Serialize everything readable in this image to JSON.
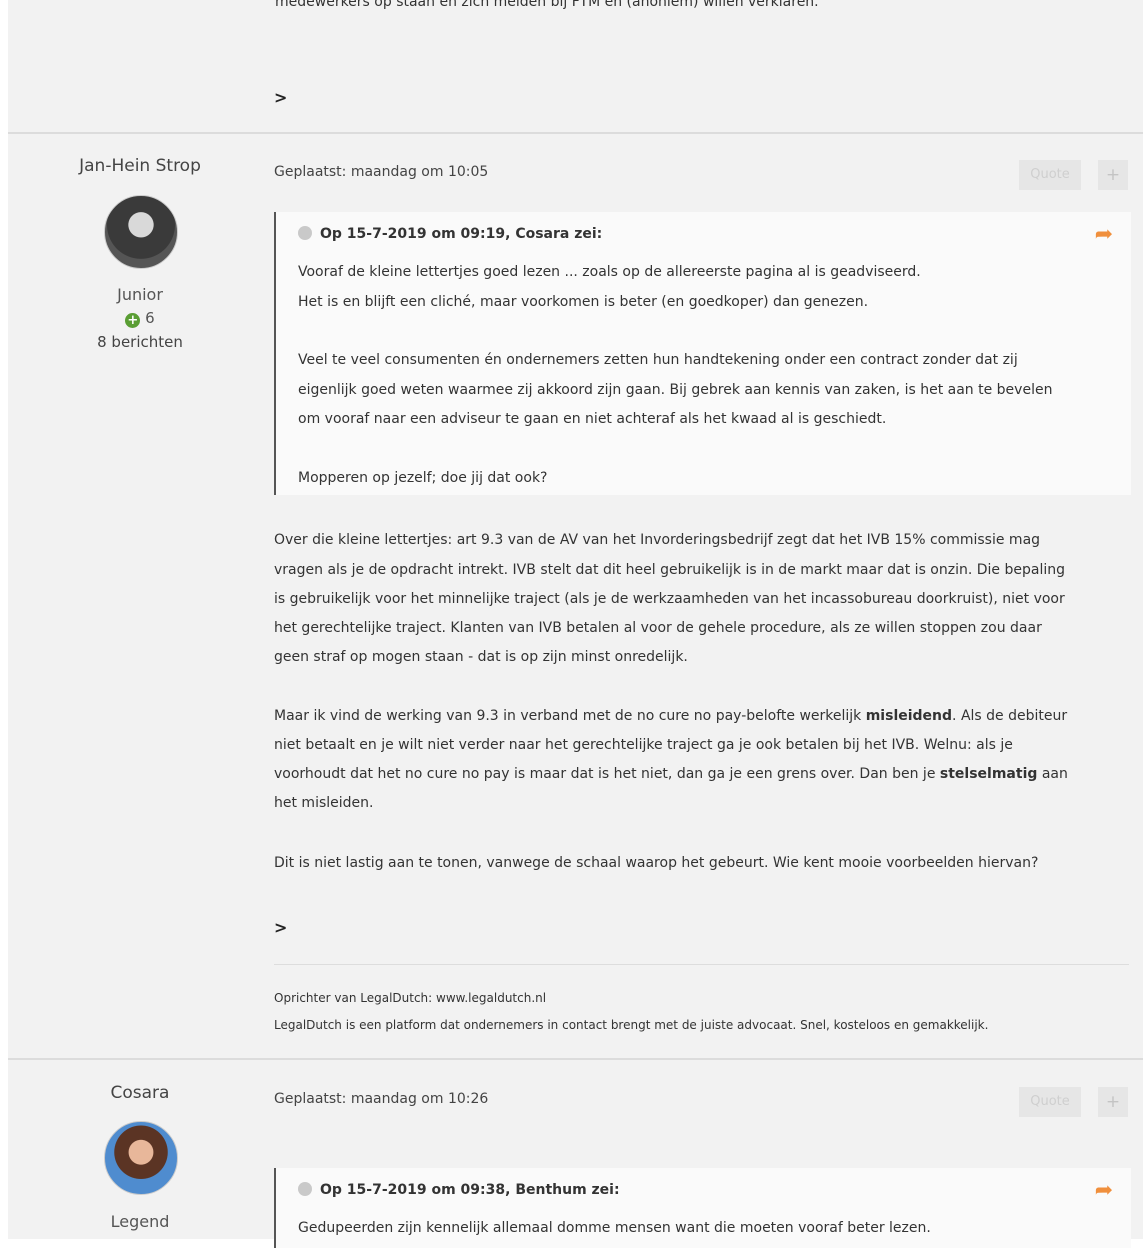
{
  "prev_post": {
    "tail_text": "medewerkers op staan en zich melden bij FTM en (anoniem) willen verklaren."
  },
  "post1": {
    "author": "Jan-Hein Strop",
    "rank": "Junior",
    "reputation": "6",
    "post_count": "8 berichten",
    "posted": "Geplaatst: maandag om 10:05",
    "quote_btn": "Quote",
    "plus_btn": "+",
    "quote": {
      "header": "Op 15-7-2019 om 09:19, Cosara zei:",
      "lines": [
        "Vooraf de kleine lettertjes goed lezen ... zoals op de allereerste pagina al is geadviseerd.",
        "Het is en blijft een cliché, maar voorkomen is beter (en goedkoper) dan genezen.",
        "Veel te veel consumenten én ondernemers zetten hun handtekening onder een contract zonder dat zij",
        "eigenlijk goed weten waarmee zij akkoord zijn gaan. Bij gebrek aan kennis van zaken, is het aan te bevelen",
        "om vooraf naar een adviseur te gaan en niet achteraf als het kwaad al is geschiedt.",
        "Mopperen op jezelf; doe jij dat ook?"
      ]
    },
    "body": {
      "p1": [
        "Over die kleine lettertjes: art 9.3 van de AV van het Invorderingsbedrijf zegt dat het IVB 15% commissie mag",
        "vragen als je de opdracht intrekt. IVB stelt dat dit heel gebruikelijk is in de markt maar dat is onzin. Die bepaling",
        "is gebruikelijk voor het minnelijke traject (als je de werkzaamheden van het incassobureau doorkruist), niet voor",
        "het gerechtelijke traject. Klanten van IVB betalen al voor de gehele procedure, als ze willen stoppen zou daar",
        "geen straf op mogen staan - dat is op zijn minst onredelijk."
      ],
      "p2_line1_pre": "Maar ik vind de werking van 9.3 in verband met de no cure no pay-belofte werkelijk ",
      "p2_line1_bold": "misleidend",
      "p2_line1_post": ". Als de debiteur",
      "p2_line2": "niet betaalt en je wilt niet verder naar het gerechtelijke traject ga je ook betalen bij het IVB. Welnu: als je",
      "p2_line3_pre": "voorhoudt dat het no cure no pay is maar dat is het niet, dan ga je een grens over. Dan ben je ",
      "p2_line3_bold": "stelselmatig",
      "p2_line3_post": " aan",
      "p2_line4": "het misleiden.",
      "p3": "Dit is niet lastig aan te tonen, vanwege de schaal waarop het gebeurt. Wie kent mooie voorbeelden hiervan?"
    },
    "signature": {
      "line1": "Oprichter van LegalDutch: www.legaldutch.nl",
      "line2": "LegalDutch is een platform dat ondernemers in contact brengt met de juiste advocaat. Snel, kosteloos en gemakkelijk."
    }
  },
  "post2": {
    "author": "Cosara",
    "rank": "Legend",
    "posted": "Geplaatst: maandag om 10:26",
    "quote_btn": "Quote",
    "plus_btn": "+",
    "quote": {
      "header": "Op 15-7-2019 om 09:38, Benthum zei:",
      "line1": "Gedupeerden zijn kennelijk allemaal domme mensen want die moeten vooraf beter lezen."
    }
  },
  "icons": {
    "share": "share-icon",
    "reply": "reply-arrow-icon",
    "quote_dot": "quote-dot-icon",
    "rep_plus": "plus-circle-icon"
  },
  "colors": {
    "reply_arrow": "#f08f3c",
    "rep_green": "#5a9e34",
    "background": "#f2f2f2"
  }
}
